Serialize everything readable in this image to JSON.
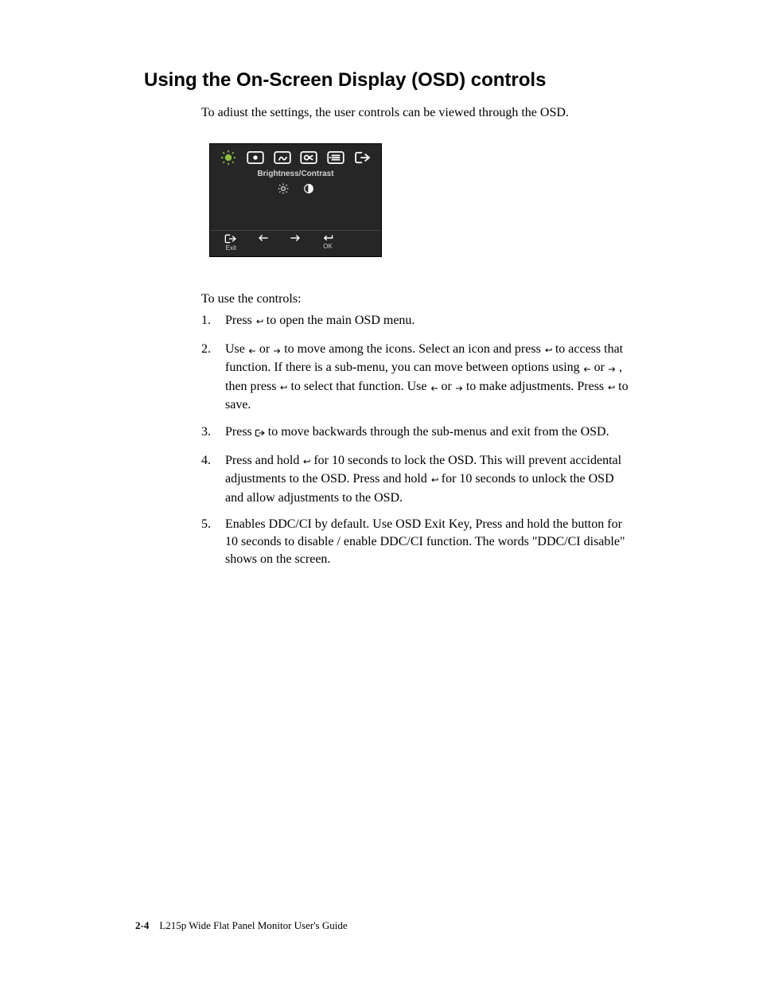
{
  "heading": "Using the On-Screen Display (OSD) controls",
  "intro": "To adiust the settings, the user controls can be viewed through the OSD.",
  "osd": {
    "title": "Brightness/Contrast",
    "exit_label": "Exit",
    "ok_label": "OK"
  },
  "to_use": "To use the controls:",
  "steps": {
    "s1_a": "Press ",
    "s1_b": " to open the main OSD menu.",
    "s2_a": "Use ",
    "s2_b": " or ",
    "s2_c": " to move among the icons. Select an icon and press ",
    "s2_d": " to access that function. If there is a sub-menu, you can move between options using ",
    "s2_e": " or ",
    "s2_f": " , then press ",
    "s2_g": " to select that function. Use ",
    "s2_h": " or ",
    "s2_i": " to make adjustments. Press ",
    "s2_j": " to save.",
    "s3_a": "Press ",
    "s3_b": " to move backwards through the sub-menus and exit from the OSD.",
    "s4_a": "Press and hold ",
    "s4_b": " for 10 seconds to lock the OSD. This will prevent accidental adjustments to the OSD. Press and hold ",
    "s4_c": " for 10  seconds to unlock the OSD and allow adjustments to the OSD.",
    "s5": "Enables DDC/CI by default. Use OSD Exit Key, Press and hold the   button for 10 seconds to disable / enable DDC/CI function. The words \"DDC/CI disable\" shows on the screen."
  },
  "footer": {
    "pageno": "2-4",
    "title": "L215p Wide Flat Panel Monitor User's Guide"
  }
}
